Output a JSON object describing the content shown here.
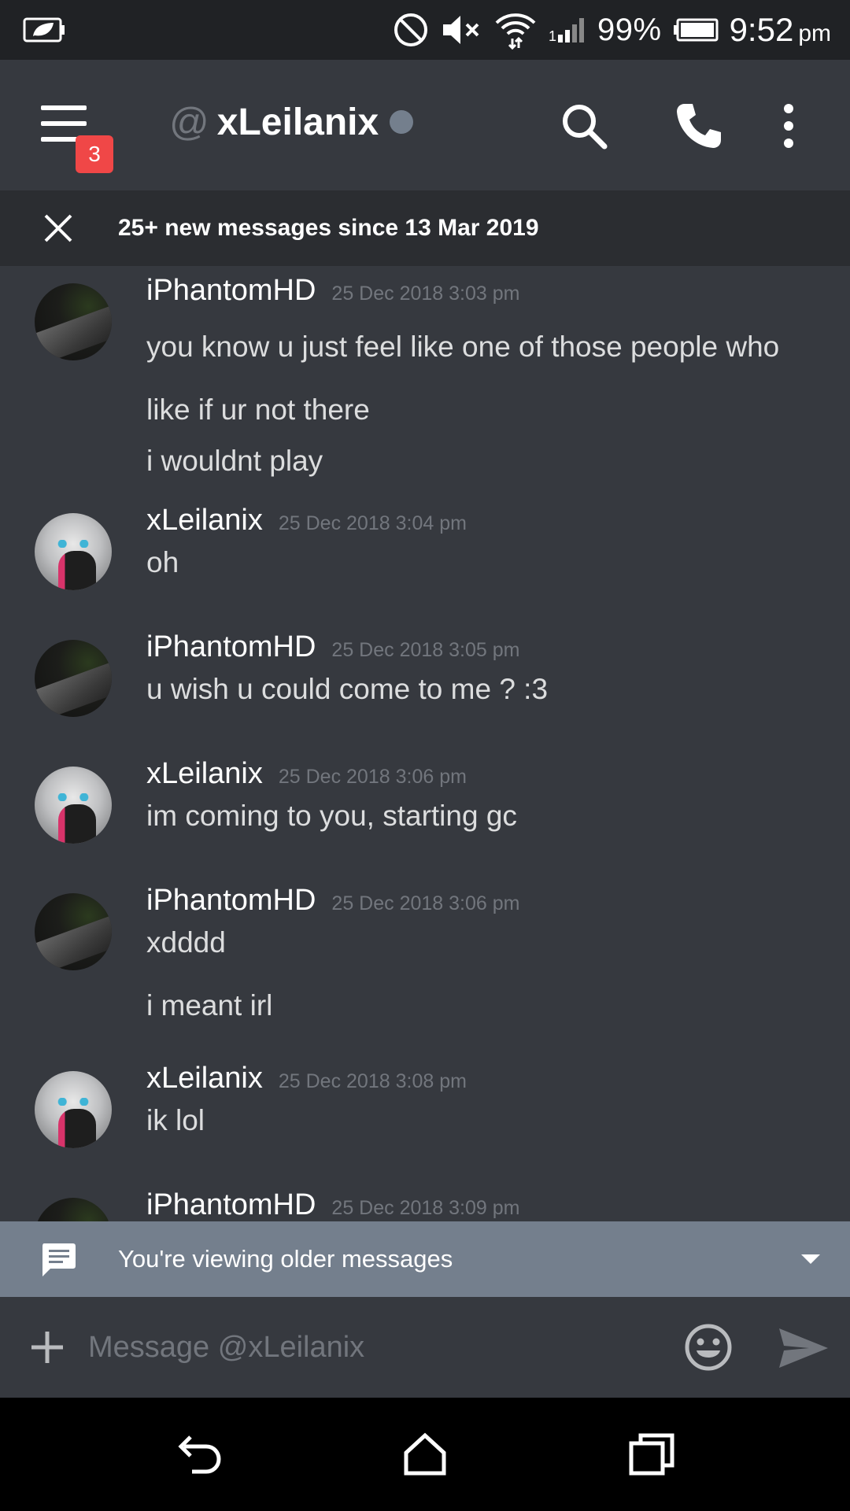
{
  "status_bar": {
    "battery_percent": "99%",
    "time": "9:52",
    "ampm": "pm",
    "icons": [
      "leaf-battery-saver-icon",
      "do-not-disturb-icon",
      "mute-icon",
      "wifi-icon",
      "signal-icon",
      "battery-icon"
    ]
  },
  "header": {
    "at_sign": "@",
    "dm_name": "xLeilanix",
    "unread_badge": "3",
    "presence_color": "#747f8d"
  },
  "new_messages_bar": {
    "text": "25+ new messages since 13 Mar 2019"
  },
  "messages": [
    {
      "author": "iPhantomHD",
      "timestamp": "25 Dec 2018 3:03 pm",
      "avatar": "phantom",
      "lines": [
        "you know u just feel like one of those people who",
        "like if ur not there",
        "i wouldnt play"
      ]
    },
    {
      "author": "xLeilanix",
      "timestamp": "25 Dec 2018 3:04 pm",
      "avatar": "leilani",
      "lines": [
        "oh"
      ]
    },
    {
      "author": "iPhantomHD",
      "timestamp": "25 Dec 2018 3:05 pm",
      "avatar": "phantom",
      "lines": [
        "u wish u could come to me ? :3"
      ]
    },
    {
      "author": "xLeilanix",
      "timestamp": "25 Dec 2018 3:06 pm",
      "avatar": "leilani",
      "lines": [
        "im coming to you, starting gc"
      ]
    },
    {
      "author": "iPhantomHD",
      "timestamp": "25 Dec 2018 3:06 pm",
      "avatar": "phantom",
      "lines": [
        "xdddd",
        "i meant irl"
      ]
    },
    {
      "author": "xLeilanix",
      "timestamp": "25 Dec 2018 3:08 pm",
      "avatar": "leilani",
      "lines": [
        "ik lol"
      ]
    },
    {
      "author": "iPhantomHD",
      "timestamp": "25 Dec 2018 3:09 pm",
      "avatar": "phantom",
      "lines": []
    }
  ],
  "older_banner": {
    "text": "You're viewing older messages"
  },
  "composer": {
    "placeholder": "Message @xLeilanix"
  },
  "colors": {
    "background": "#36393f",
    "header_dark": "#202225",
    "badge": "#f04747",
    "older_banner": "#747f8d"
  }
}
